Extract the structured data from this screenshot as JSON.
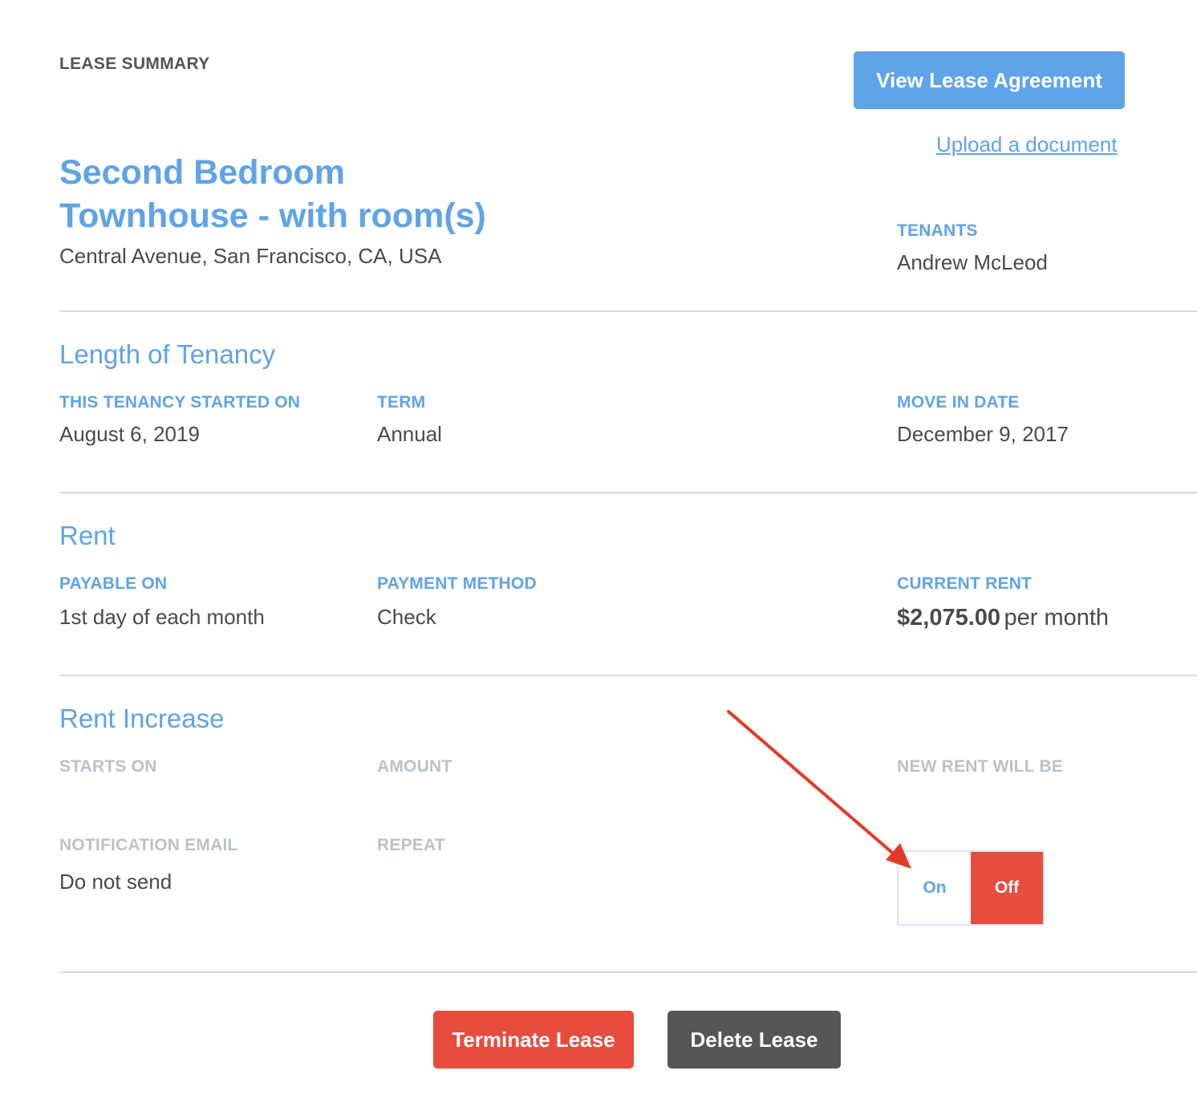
{
  "header": {
    "eyebrow": "LEASE SUMMARY",
    "view_lease_button": "View Lease Agreement",
    "upload_link": "Upload a document"
  },
  "property": {
    "title_line1": "Second Bedroom",
    "title_line2": "Townhouse - with room(s)",
    "address": "Central Avenue, San Francisco, CA, USA"
  },
  "tenants": {
    "label": "TENANTS",
    "value": "Andrew McLeod"
  },
  "tenancy": {
    "heading": "Length of Tenancy",
    "started_label": "THIS TENANCY STARTED ON",
    "started_value": "August 6, 2019",
    "term_label": "TERM",
    "term_value": "Annual",
    "move_in_label": "MOVE IN DATE",
    "move_in_value": "December 9, 2017"
  },
  "rent": {
    "heading": "Rent",
    "payable_label": "PAYABLE ON",
    "payable_value": "1st day of each month",
    "method_label": "PAYMENT METHOD",
    "method_value": "Check",
    "current_label": "CURRENT RENT",
    "current_amount": "$2,075.00",
    "current_unit": "per month"
  },
  "rent_increase": {
    "heading": "Rent Increase",
    "starts_label": "STARTS ON",
    "amount_label": "AMOUNT",
    "new_rent_label": "NEW RENT WILL BE",
    "notification_label": "NOTIFICATION EMAIL",
    "notification_value": "Do not send",
    "repeat_label": "REPEAT",
    "toggle_on": "On",
    "toggle_off": "Off",
    "toggle_selected": "Off"
  },
  "actions": {
    "terminate": "Terminate Lease",
    "delete": "Delete Lease"
  },
  "colors": {
    "accent": "#5fa3e8",
    "danger": "#e84c3d",
    "dark_button": "#565656",
    "muted_label": "#b9c2c9",
    "annotation_arrow": "#e23b2a"
  }
}
